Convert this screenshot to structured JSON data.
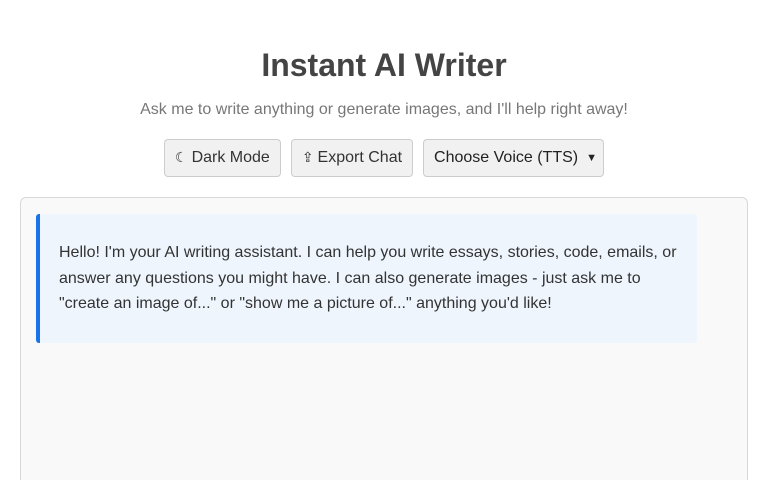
{
  "header": {
    "title": "Instant AI Writer",
    "subtitle": "Ask me to write anything or generate images, and I'll help right away!"
  },
  "controls": {
    "dark_mode": {
      "icon": "moon-icon",
      "label": "Dark Mode"
    },
    "export_chat": {
      "icon": "export-icon",
      "label": "Export Chat"
    },
    "voice_select": {
      "selected": "Choose Voice (TTS)"
    }
  },
  "chat": {
    "messages": [
      {
        "role": "assistant",
        "text": "Hello! I'm your AI writing assistant. I can help you write essays, stories, code, emails, or answer any questions you might have. I can also generate images - just ask me to \"create an image of...\" or \"show me a picture of...\" anything you'd like!"
      }
    ]
  },
  "colors": {
    "accent": "#1a73e8",
    "message_bg": "#eef5fd",
    "title": "#444444",
    "subtitle": "#777777"
  }
}
